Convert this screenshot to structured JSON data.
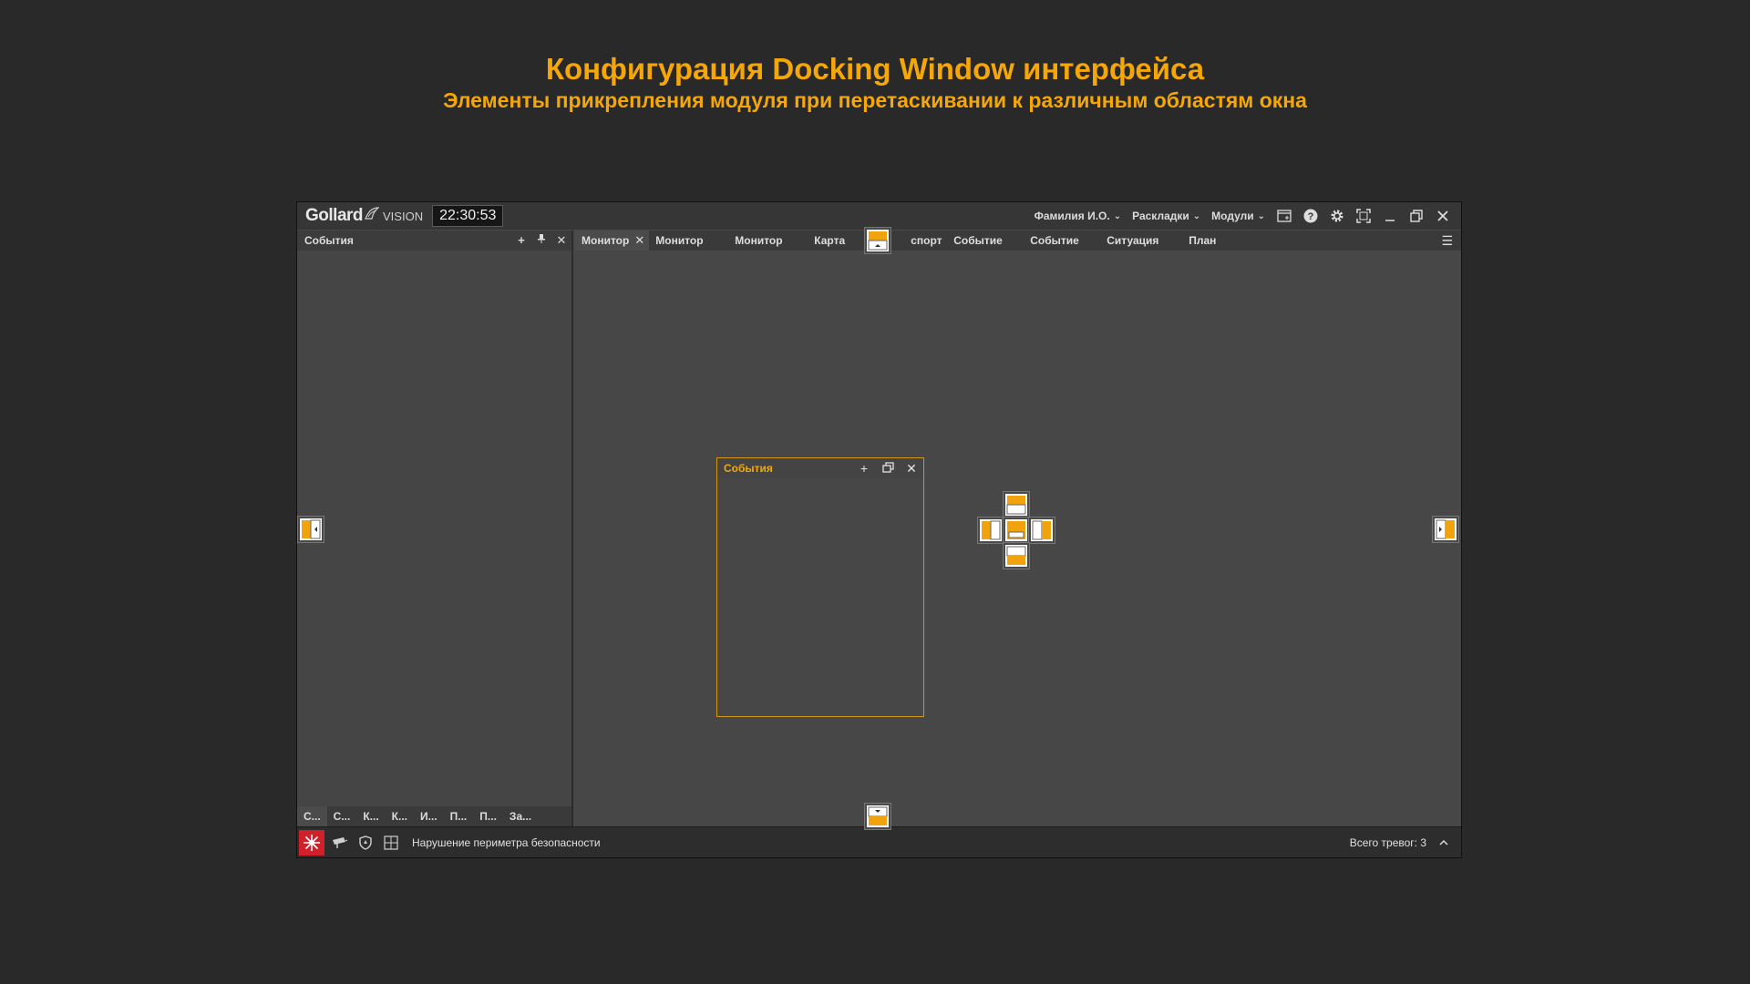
{
  "heading": {
    "title": "Конфигурация Docking Window интерфейса",
    "subtitle": "Элементы прикрепления модуля при перетаскивании к различным областям окна"
  },
  "colors": {
    "accent": "#f5a70a",
    "alarm": "#d0202a"
  },
  "titlebar": {
    "logo_main": "Gollard",
    "logo_sub": "VISION",
    "clock": "22:30:53",
    "menus": [
      {
        "label": "Фамилия И.О.",
        "icon": "chevron-down-icon"
      },
      {
        "label": "Раскладки",
        "icon": "chevron-down-icon"
      },
      {
        "label": "Модули",
        "icon": "chevron-down-icon"
      }
    ],
    "icons": [
      "new-window-icon",
      "help-icon",
      "gear-icon",
      "fullscreen-icon",
      "minimize-icon",
      "restore-icon",
      "close-icon"
    ]
  },
  "left_panel": {
    "title": "События",
    "bottom_tabs": [
      "С...",
      "С...",
      "К...",
      "К...",
      "И...",
      "П...",
      "П...",
      "За..."
    ]
  },
  "doc_tabs": {
    "items": [
      "Монитор",
      "Монитор",
      "Монитор",
      "Карта",
      "спорт",
      "Событие",
      "Событие",
      "Ситуация",
      "План"
    ],
    "active_index": 0
  },
  "floating_panel": {
    "title": "События"
  },
  "statusbar": {
    "message": "Нарушение периметра безопасности",
    "total": "Всего тревог: 3"
  }
}
